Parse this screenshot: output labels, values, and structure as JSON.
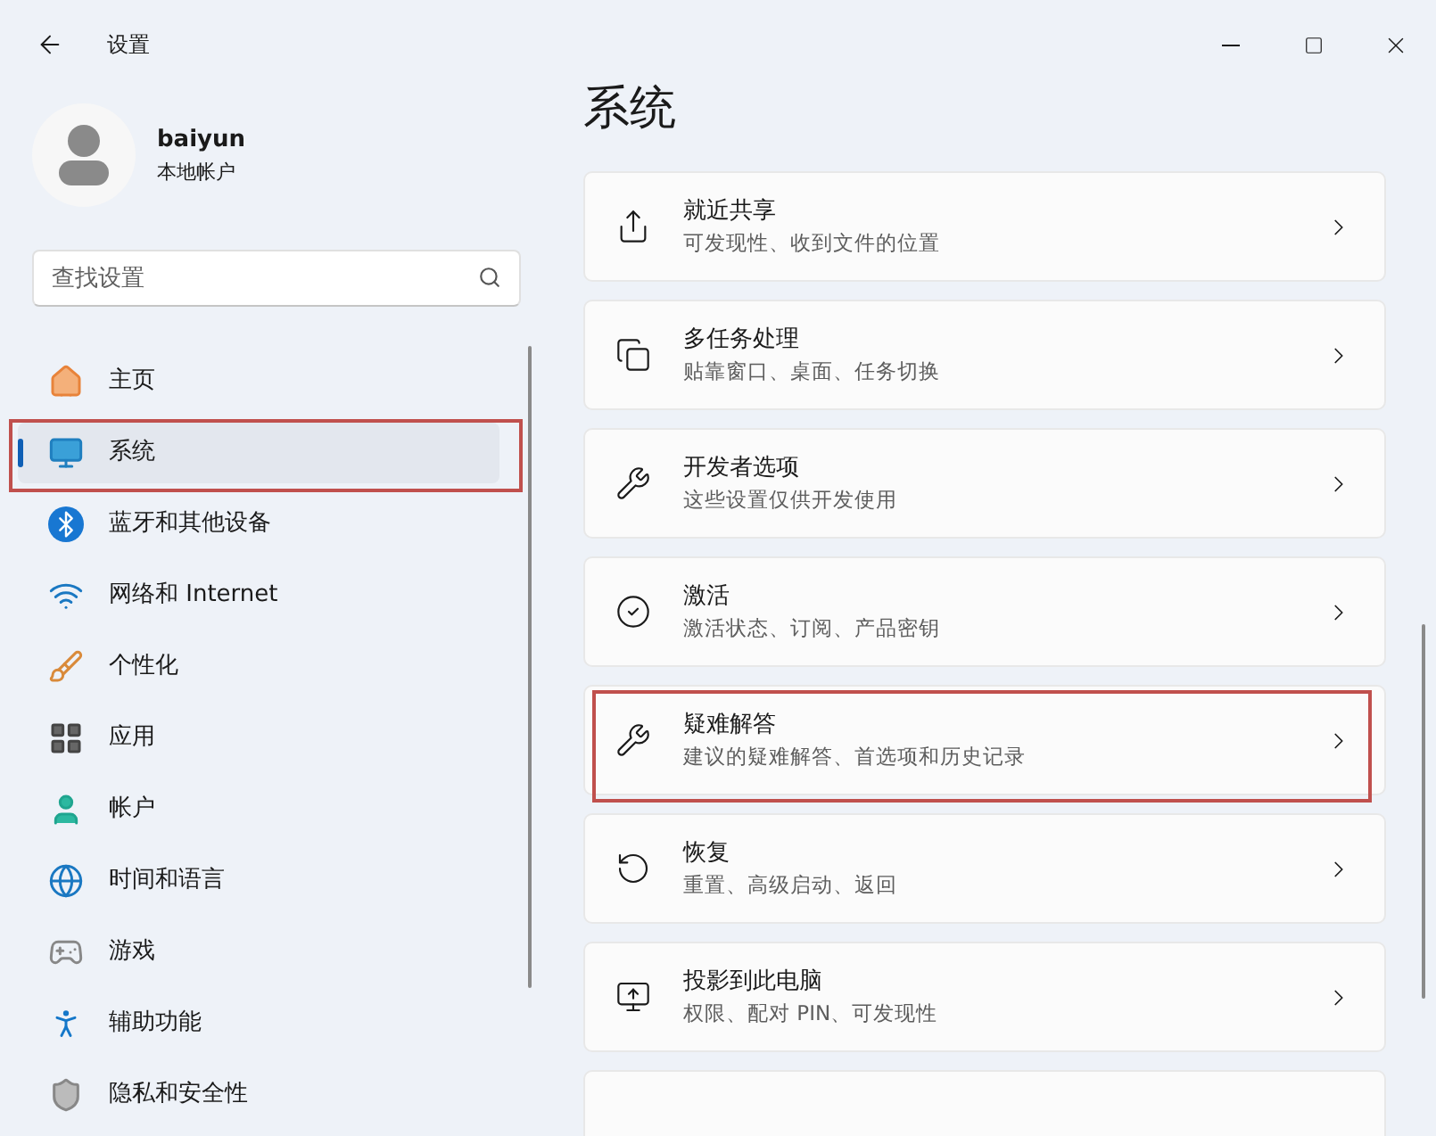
{
  "window": {
    "title": "设置"
  },
  "account": {
    "name": "baiyun",
    "type": "本地帐户"
  },
  "search": {
    "placeholder": "查找设置"
  },
  "sidebar": {
    "items": [
      {
        "label": "主页",
        "selected": false,
        "annotated": false
      },
      {
        "label": "系统",
        "selected": true,
        "annotated": true
      },
      {
        "label": "蓝牙和其他设备",
        "selected": false,
        "annotated": false
      },
      {
        "label": "网络和 Internet",
        "selected": false,
        "annotated": false
      },
      {
        "label": "个性化",
        "selected": false,
        "annotated": false
      },
      {
        "label": "应用",
        "selected": false,
        "annotated": false
      },
      {
        "label": "帐户",
        "selected": false,
        "annotated": false
      },
      {
        "label": "时间和语言",
        "selected": false,
        "annotated": false
      },
      {
        "label": "游戏",
        "selected": false,
        "annotated": false
      },
      {
        "label": "辅助功能",
        "selected": false,
        "annotated": false
      },
      {
        "label": "隐私和安全性",
        "selected": false,
        "annotated": false
      }
    ]
  },
  "page_title": "系统",
  "settings": [
    {
      "title": "就近共享",
      "description": "可发现性、收到文件的位置",
      "annotated": false
    },
    {
      "title": "多任务处理",
      "description": "贴靠窗口、桌面、任务切换",
      "annotated": false
    },
    {
      "title": "开发者选项",
      "description": "这些设置仅供开发使用",
      "annotated": false
    },
    {
      "title": "激活",
      "description": "激活状态、订阅、产品密钥",
      "annotated": false
    },
    {
      "title": "疑难解答",
      "description": "建议的疑难解答、首选项和历史记录",
      "annotated": true
    },
    {
      "title": "恢复",
      "description": "重置、高级启动、返回",
      "annotated": false
    },
    {
      "title": "投影到此电脑",
      "description": "权限、配对 PIN、可发现性",
      "annotated": false
    }
  ]
}
